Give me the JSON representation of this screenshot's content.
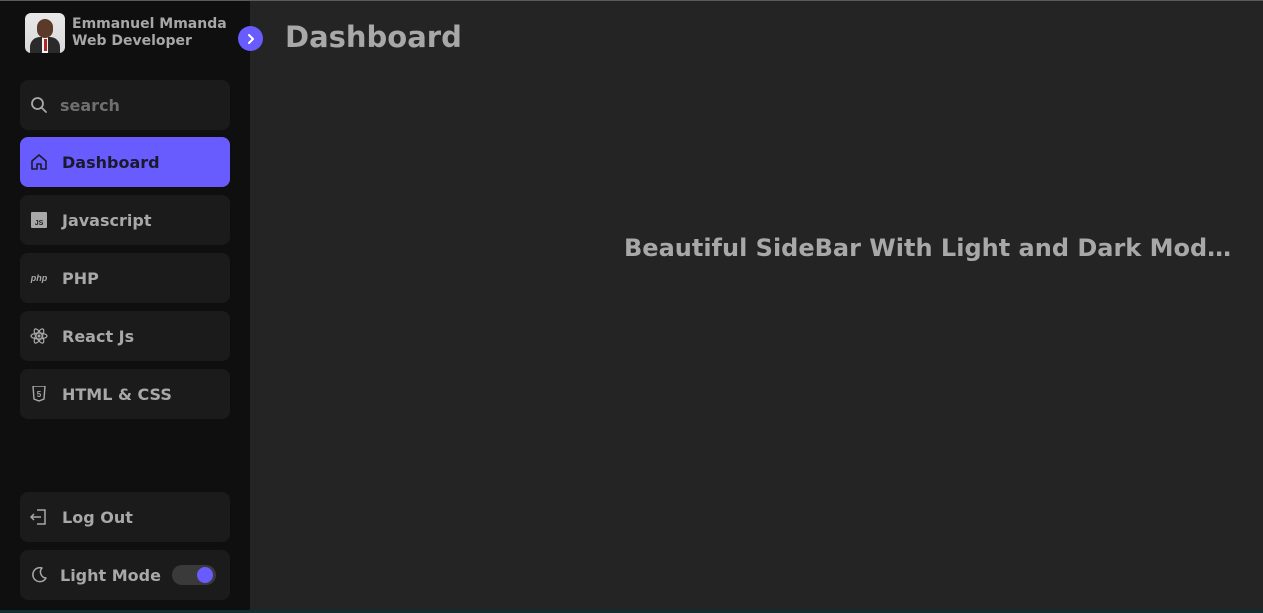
{
  "profile": {
    "name": "Emmanuel Mmanda",
    "role": "Web Developer"
  },
  "search": {
    "placeholder": "search"
  },
  "menu": {
    "items": [
      {
        "label": "Dashboard",
        "icon": "home-icon",
        "active": true
      },
      {
        "label": "Javascript",
        "icon": "javascript-icon",
        "active": false
      },
      {
        "label": "PHP",
        "icon": "php-icon",
        "active": false
      },
      {
        "label": "React Js",
        "icon": "react-icon",
        "active": false
      },
      {
        "label": "HTML & CSS",
        "icon": "html5-icon",
        "active": false
      }
    ]
  },
  "bottom": {
    "logout_label": "Log Out",
    "mode_label": "Light Mode"
  },
  "icon_texts": {
    "js": "JS",
    "php": "php",
    "html5": "5"
  },
  "main": {
    "title": "Dashboard",
    "subtitle": "Beautiful SideBar With Light and Dark Mode ..."
  },
  "colors": {
    "accent": "#695cfe",
    "sidebar_bg": "#0f0f0f",
    "main_bg": "#242424",
    "item_bg": "#1b1b1b",
    "text": "#a8a8a8"
  }
}
